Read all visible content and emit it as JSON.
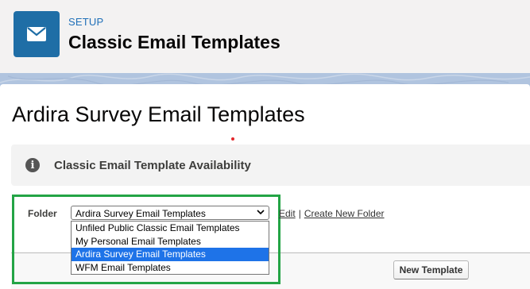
{
  "header": {
    "section_label": "SETUP",
    "title": "Classic Email Templates"
  },
  "page": {
    "title": "Ardira Survey Email Templates"
  },
  "notice": {
    "title": "Classic Email Template Availability"
  },
  "folder": {
    "label": "Folder",
    "selected": "Ardira Survey Email Templates",
    "options": [
      "Unfiled Public Classic Email Templates",
      "My Personal Email Templates",
      "Ardira Survey Email Templates",
      "WFM Email Templates"
    ],
    "selected_index": 2,
    "edit_link": "Edit",
    "separator": "|",
    "create_link": "Create New Folder"
  },
  "actions": {
    "new_template": "New Template"
  },
  "colors": {
    "header_icon_bg": "#1f6ea6",
    "highlight": "#23a445",
    "selected_option": "#1e73e8",
    "link_blue": "#2070b8"
  },
  "icons": {
    "header": "envelope-icon",
    "notice": "info-icon",
    "select": "chevron-down-icon"
  }
}
